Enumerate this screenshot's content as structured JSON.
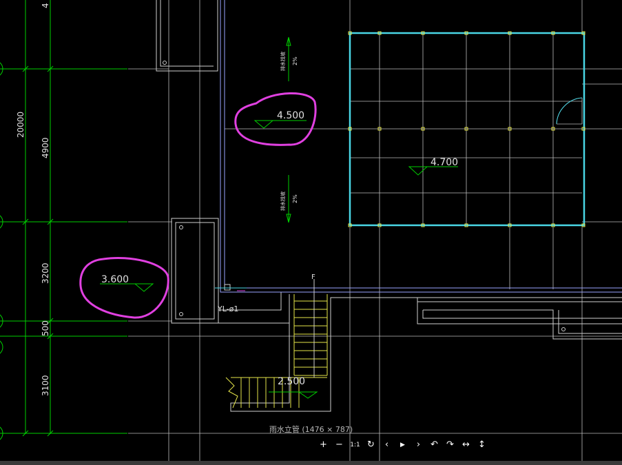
{
  "viewer": {
    "caption": "雨水立管 (1476 × 787)",
    "toolbar": [
      {
        "name": "zoom-in-button",
        "glyph": "+"
      },
      {
        "name": "zoom-out-button",
        "glyph": "−"
      },
      {
        "name": "actual-size-button",
        "glyph": "1:1"
      },
      {
        "name": "rotate-button",
        "glyph": "↻"
      },
      {
        "name": "previous-button",
        "glyph": "‹"
      },
      {
        "name": "play-button",
        "glyph": "▶"
      },
      {
        "name": "next-button",
        "glyph": "›"
      },
      {
        "name": "undo-button",
        "glyph": "↶"
      },
      {
        "name": "redo-button",
        "glyph": "↷"
      },
      {
        "name": "fit-width-button",
        "glyph": "↔"
      },
      {
        "name": "fit-height-button",
        "glyph": "↕"
      }
    ]
  },
  "drawing": {
    "dims": [
      "20000",
      "4900",
      "3200",
      "500",
      "3100"
    ],
    "dim_top": "4",
    "elevations": {
      "left_annotated": "3.600",
      "center_annotated": "4.500",
      "roof": "4.700",
      "stair": "2.500"
    },
    "slope_labels": [
      "排水找坡\n2%",
      "排水找坡\n2%"
    ],
    "slope_text": "2%",
    "slope_text_cn": "排水找坡",
    "pipe_label": "YL-ø1",
    "stair_mark": "F",
    "colors": {
      "grid": "#00d000",
      "lines": "#d0d0d0",
      "cyan": "#4ad7e6",
      "yellow": "#e6e64a",
      "magenta": "#e040e0",
      "wall_blue": "#9aa3ff"
    }
  }
}
